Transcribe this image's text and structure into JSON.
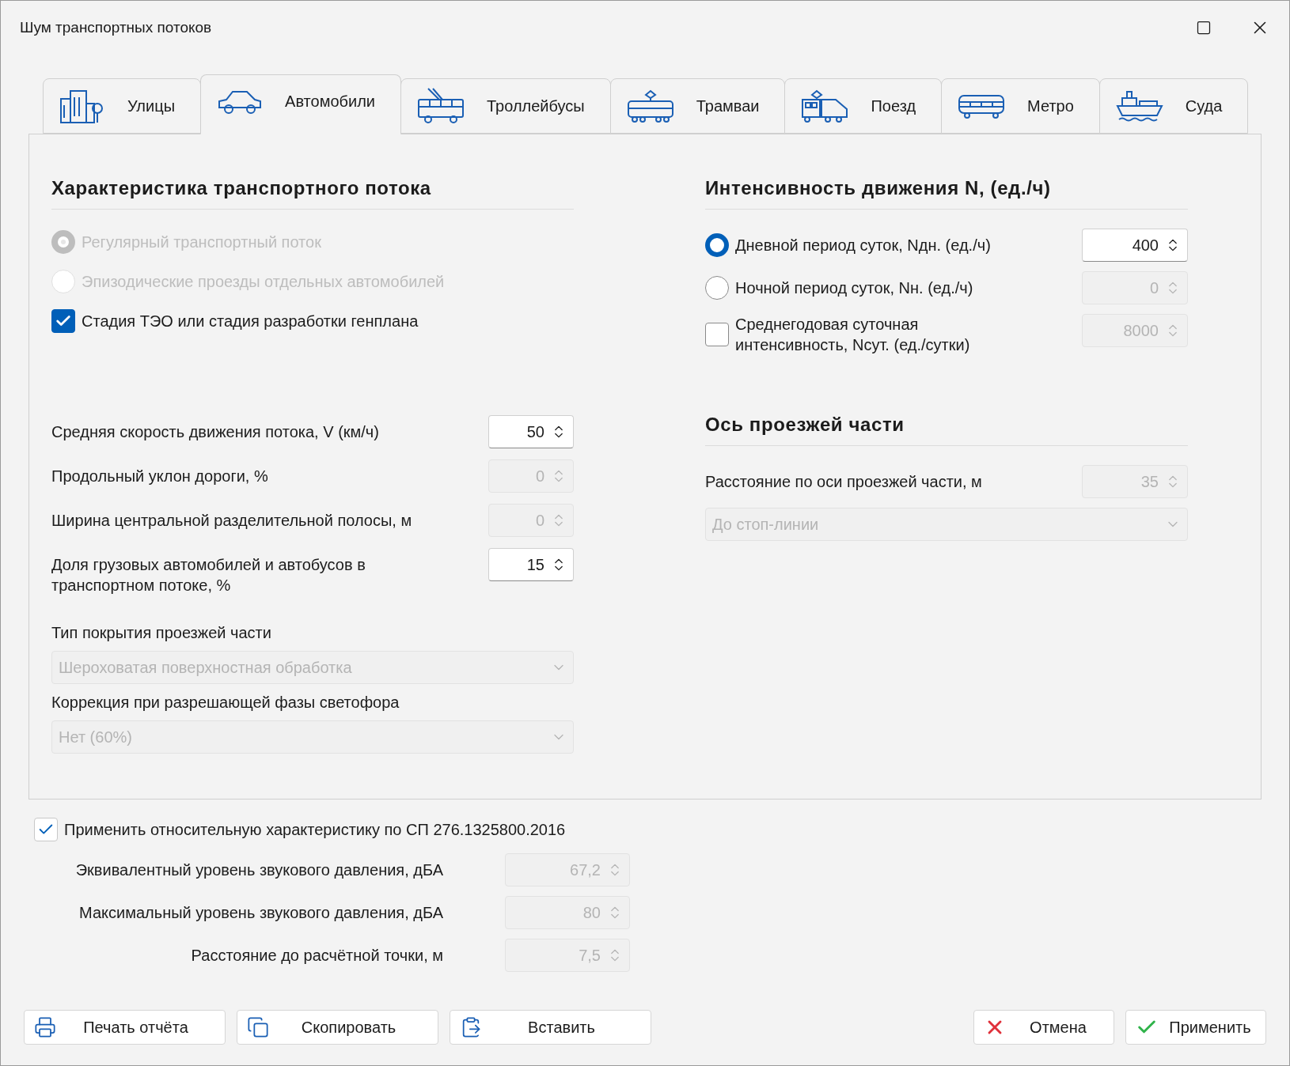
{
  "window": {
    "title": "Шум транспортных потоков"
  },
  "tabs": [
    {
      "label": "Улицы",
      "kind": "city",
      "selected": false
    },
    {
      "label": "Автомобили",
      "kind": "car",
      "selected": true
    },
    {
      "label": "Троллейбусы",
      "kind": "trolleybus",
      "selected": false
    },
    {
      "label": "Трамваи",
      "kind": "tram",
      "selected": false
    },
    {
      "label": "Поезд",
      "kind": "train",
      "selected": false
    },
    {
      "label": "Метро",
      "kind": "metro",
      "selected": false
    },
    {
      "label": "Суда",
      "kind": "ship",
      "selected": false
    }
  ],
  "flow": {
    "heading": "Характеристика транспортного потока",
    "options": [
      {
        "kind": "radio",
        "label": "Регулярный транспортный поток",
        "selected": true,
        "disabled": true
      },
      {
        "kind": "radio",
        "label": "Эпизодические проезды отдельных автомобилей",
        "selected": false,
        "disabled": true
      },
      {
        "kind": "checkbox",
        "label": "Стадия ТЭО или стадия разработки генплана",
        "checked": true,
        "disabled": false
      }
    ],
    "fields": [
      {
        "label": "Средняя скорость движения потока, V (км/ч)",
        "value": "50",
        "disabled": false
      },
      {
        "label": "Продольный уклон дороги, %",
        "value": "0",
        "disabled": true
      },
      {
        "label": "Ширина центральной разделительной полосы, м",
        "value": "0",
        "disabled": true
      },
      {
        "label": "Доля грузовых автомобилей и автобусов в транспортном потоке, %",
        "value": "15",
        "disabled": false
      }
    ],
    "selects": [
      {
        "label": "Тип покрытия проезжей части",
        "value": "Шероховатая поверхностная обработка",
        "disabled": true
      },
      {
        "label": "Коррекция при разрешающей фазы светофора",
        "value": "Нет (60%)",
        "disabled": true
      }
    ]
  },
  "intensity": {
    "heading": "Интенсивность движения N, (ед./ч)",
    "rows": [
      {
        "kind": "radio",
        "label": "Дневной период суток, Nдн. (ед./ч)",
        "selected": true,
        "value": "400",
        "disabled": false
      },
      {
        "kind": "radio",
        "label": "Ночной период суток, Nн. (ед./ч)",
        "selected": false,
        "value": "0",
        "disabled": true
      },
      {
        "kind": "checkbox",
        "label": "Среднегодовая суточная интенсивность, Nсут. (ед./сутки)",
        "checked": false,
        "value": "8000",
        "disabled": true
      }
    ]
  },
  "axis": {
    "heading": "Ось проезжей части",
    "field": {
      "label": "Расстояние по оси проезжей части, м",
      "value": "35",
      "disabled": true
    },
    "select": {
      "value": "До стоп-линии",
      "disabled": true
    }
  },
  "relative": {
    "label": "Применить относительную характеристику по СП 276.1325800.2016",
    "checked": true
  },
  "levels": [
    {
      "label": "Эквивалентный уровень звукового давления, дБА",
      "value": "67,2",
      "disabled": true
    },
    {
      "label": "Максимальный уровень звукового давления, дБА",
      "value": "80",
      "disabled": true
    },
    {
      "label": "Расстояние до расчётной точки, м",
      "value": "7,5",
      "disabled": true
    }
  ],
  "buttons": [
    {
      "label": "Печать отчёта",
      "kind": "print"
    },
    {
      "label": "Скопировать",
      "kind": "copy"
    },
    {
      "label": "Вставить",
      "kind": "paste"
    }
  ],
  "actions": [
    {
      "label": "Отмена",
      "kind": "cancel"
    },
    {
      "label": "Применить",
      "kind": "apply"
    }
  ]
}
